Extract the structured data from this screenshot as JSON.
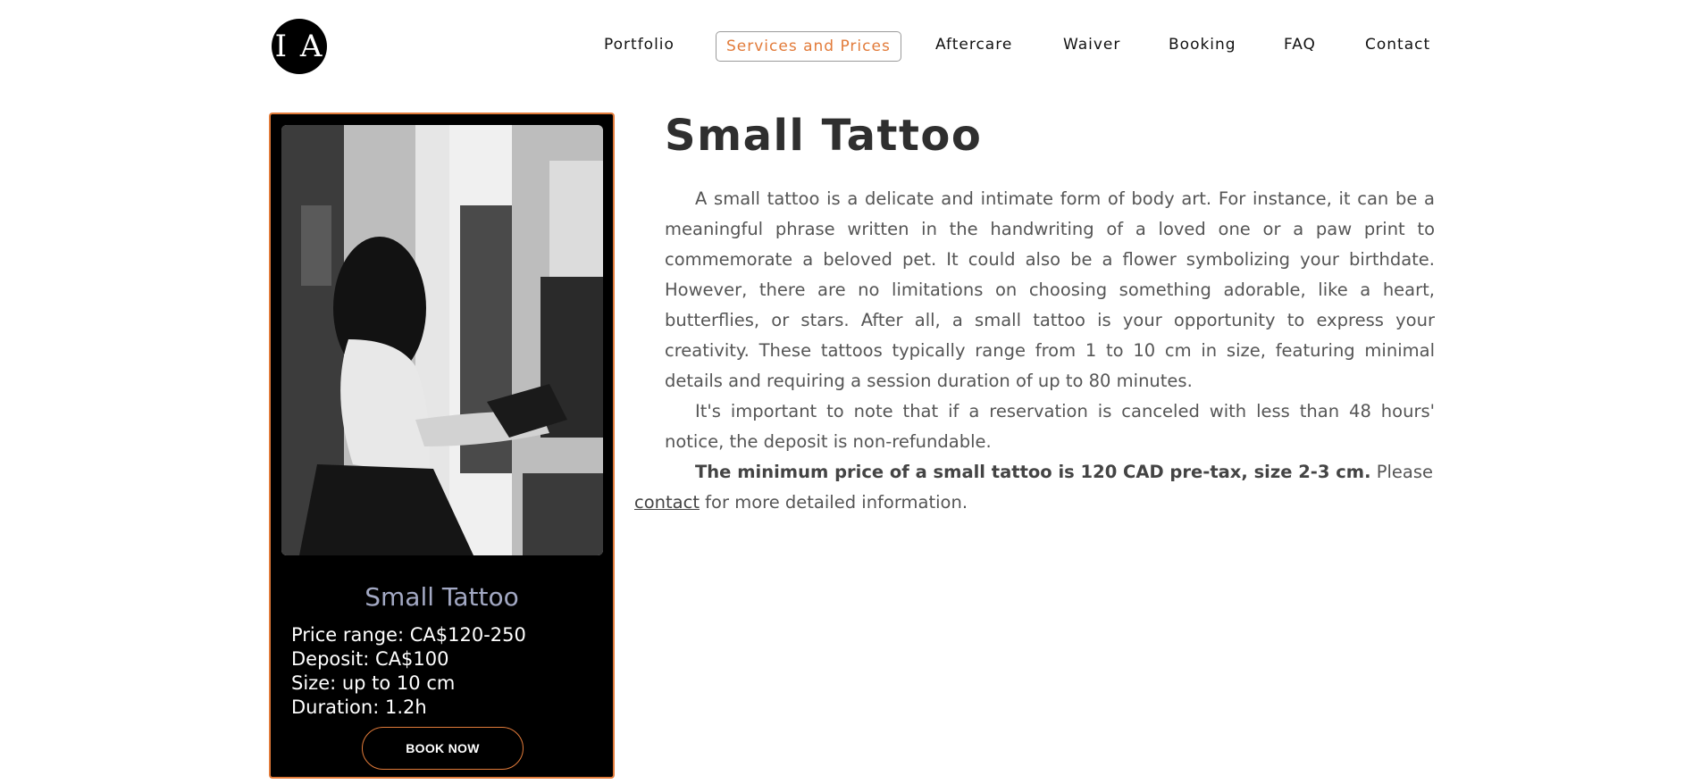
{
  "logo": {
    "text": "I A"
  },
  "nav": {
    "items": [
      "Portfolio",
      "Services and Prices",
      "Aftercare",
      "Waiver",
      "Booking",
      "FAQ",
      "Contact"
    ],
    "active": "Services and Prices"
  },
  "card": {
    "title": "Small Tattoo",
    "details": {
      "price": "Price range: CA$120-250",
      "deposit": "Deposit: CA$100",
      "size": "Size: up to 10 cm",
      "duration": "Duration: 1.2h"
    },
    "button": "BOOK NOW"
  },
  "main": {
    "title": "Small Tattoo",
    "paragraph1": "A small tattoo is a delicate and intimate form of body art. For instance, it can be a meaningful phrase written in the handwriting of a loved one or a paw print to commemorate a beloved pet. It could also be a flower symbolizing your birthdate. However, there are no limitations on choosing something adorable, like a heart, butterflies, or stars. After all, a small tattoo is your opportunity to express your creativity. These tattoos typically range from 1 to 10 cm in size, featuring minimal details and requiring a session duration of up to 80 minutes.",
    "paragraph2": "It's important to note that if a reservation is canceled with less than 48 hours' notice, the deposit is non-refundable.",
    "paragraph3_bold": "The minimum price of a small tattoo is 120 CAD pre-tax, size 2-3 cm.",
    "paragraph3_pre": " Please",
    "paragraph3_link": "contact",
    "paragraph3_post": " for more detailed information."
  },
  "colors": {
    "accent": "#e27b3a",
    "card_bg": "#000000",
    "card_title": "#a3a9c4"
  }
}
